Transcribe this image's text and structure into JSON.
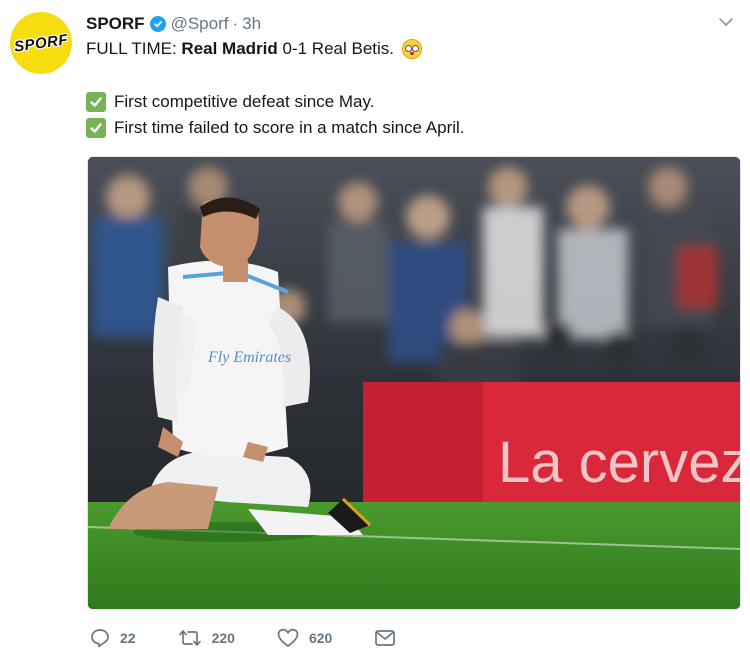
{
  "tweet": {
    "account_name": "SPORF",
    "handle": "@Sporf",
    "separator": "·",
    "time": "3h",
    "avatar_text": "SPORF",
    "line1_prefix": "FULL TIME:",
    "home_team": "Real Madrid",
    "score": "0-1 Real Betis.",
    "emoji": "flushed-face-emoji",
    "facts": [
      "First competitive defeat since May.",
      "First time failed to score in a match since April."
    ],
    "check_icon": "check-mark-button-icon",
    "photo": {
      "kit_text": "Fly Emirates",
      "banner_text": "La cervez"
    }
  },
  "actions": {
    "reply_count": "22",
    "retweet_count": "220",
    "like_count": "620"
  },
  "colors": {
    "avatar_bg": "#f7dc0f",
    "verified": "#1da1f2",
    "check": "#77b255",
    "muted": "#657786"
  }
}
